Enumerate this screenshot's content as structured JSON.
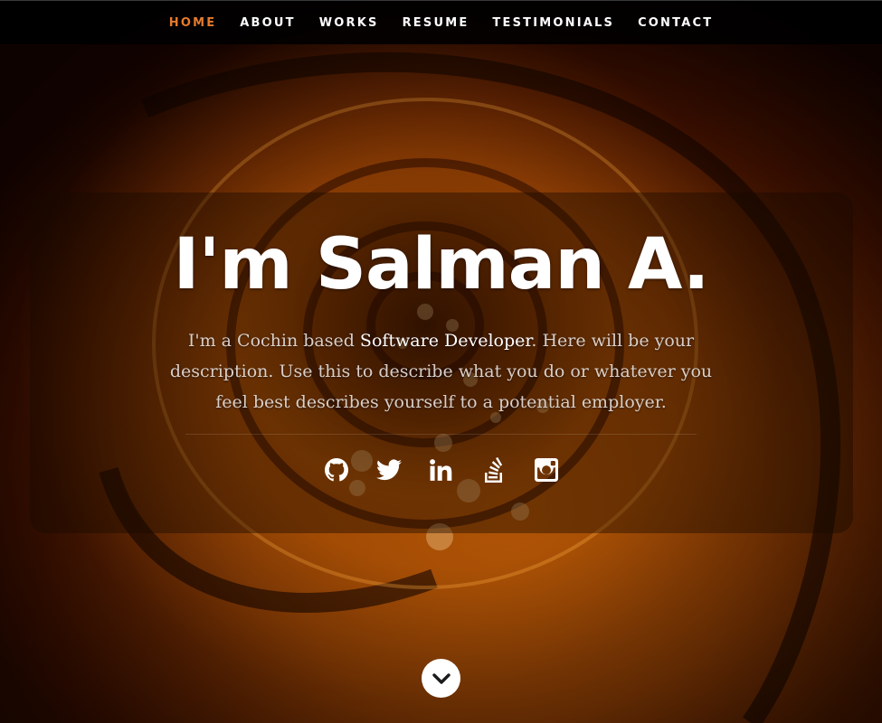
{
  "nav": {
    "items": [
      {
        "label": "HOME",
        "active": true
      },
      {
        "label": "ABOUT",
        "active": false
      },
      {
        "label": "WORKS",
        "active": false
      },
      {
        "label": "RESUME",
        "active": false
      },
      {
        "label": "TESTIMONIALS",
        "active": false
      },
      {
        "label": "CONTACT",
        "active": false
      }
    ],
    "active_color": "#e57a2c"
  },
  "banner": {
    "headline": "I'm Salman A.",
    "description_part1": "I'm a Cochin based ",
    "description_highlight": "Software Developer",
    "description_part2": ". Here will be your description. Use this to describe what you do or whatever you feel best describes yourself to a potential employer."
  },
  "social": [
    {
      "icon": "github-icon"
    },
    {
      "icon": "twitter-icon"
    },
    {
      "icon": "linkedin-icon"
    },
    {
      "icon": "stackoverflow-icon"
    },
    {
      "icon": "instagram-icon"
    }
  ],
  "scroll_down": {
    "icon": "chevron-down-icon"
  },
  "colors": {
    "accent": "#e57a2c",
    "background": "#8a3c04"
  }
}
